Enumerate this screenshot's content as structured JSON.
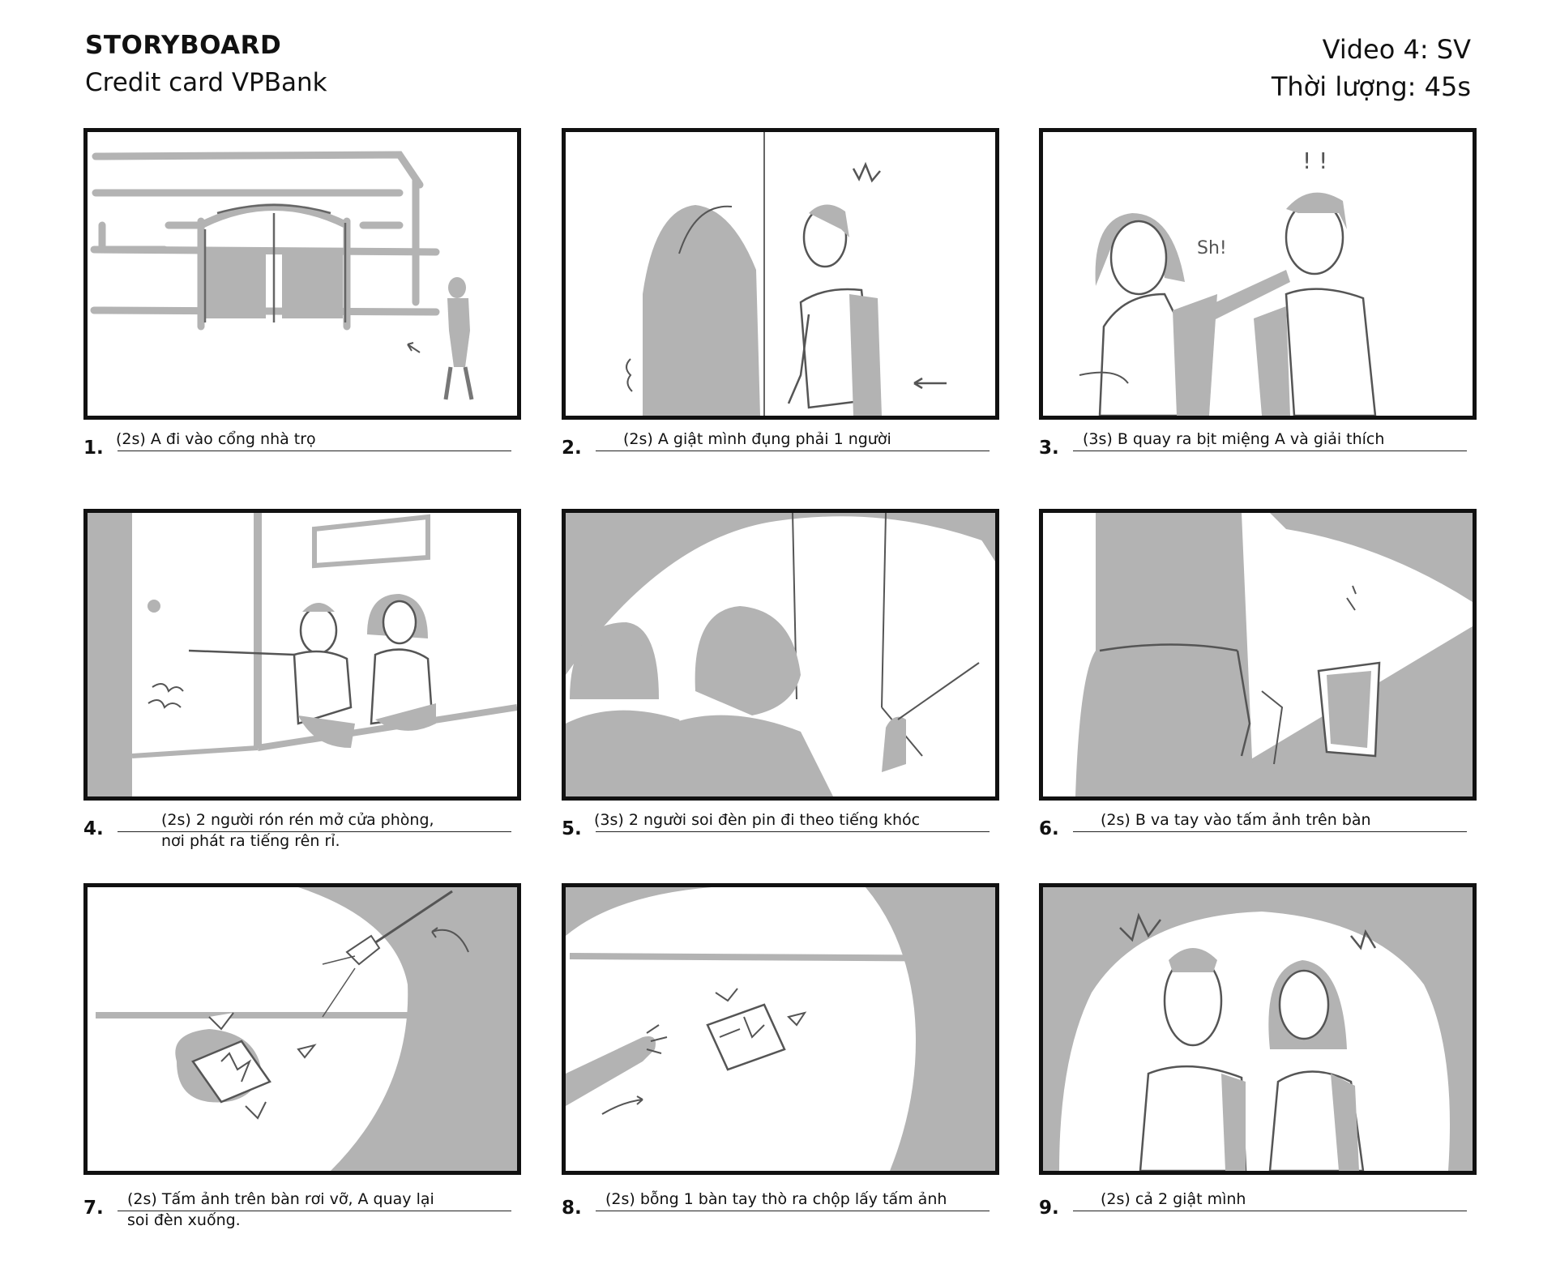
{
  "header": {
    "title": "STORYBOARD",
    "subtitle": "Credit card VPBank",
    "video": "Video 4: SV",
    "duration": "Thời lượng: 45s"
  },
  "panels": [
    {
      "number": "1.",
      "caption_line1": "(2s) A đi vào cổng nhà trọ",
      "caption_line2": ""
    },
    {
      "number": "2.",
      "caption_line1": "(2s) A giật mình đụng phải 1 người",
      "caption_line2": ""
    },
    {
      "number": "3.",
      "caption_line1": "(3s) B quay ra bịt miệng A và giải thích",
      "caption_line2": ""
    },
    {
      "number": "4.",
      "caption_line1": "(2s) 2 người rón rén mở cửa phòng,",
      "caption_line2": "nơi phát ra tiếng rên rỉ."
    },
    {
      "number": "5.",
      "caption_line1": "(3s) 2 người soi đèn pin đi theo tiếng khóc",
      "caption_line2": ""
    },
    {
      "number": "6.",
      "caption_line1": "(2s) B va tay vào tấm ảnh trên bàn",
      "caption_line2": ""
    },
    {
      "number": "7.",
      "caption_line1": "(2s) Tấm ảnh trên bàn rơi vỡ, A quay lại",
      "caption_line2": "soi đèn xuống."
    },
    {
      "number": "8.",
      "caption_line1": "(2s) bỗng 1 bàn tay thò ra chộp lấy tấm ảnh",
      "caption_line2": ""
    },
    {
      "number": "9.",
      "caption_line1": "(2s) cả 2 giật mình",
      "caption_line2": ""
    }
  ],
  "sketch_text": {
    "shh": "Sh!",
    "exclaim": "! !"
  },
  "colors": {
    "ink": "#111111",
    "sketch_gray": "#b3b3b3",
    "sketch_line": "#555555"
  }
}
